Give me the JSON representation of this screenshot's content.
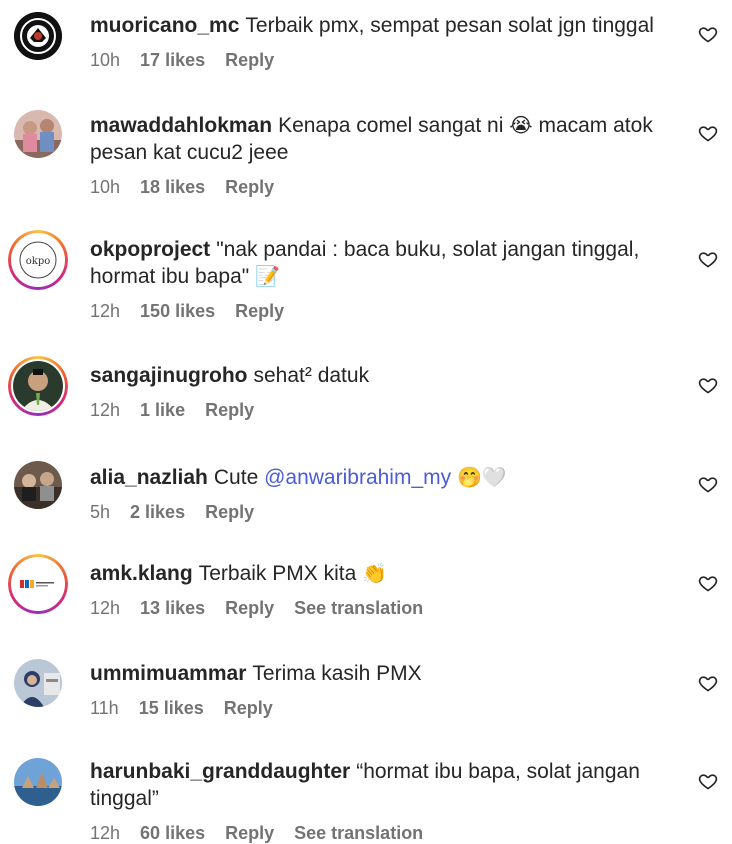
{
  "comments": [
    {
      "username": "muoricano_mc",
      "text": "Terbaik pmx, sempat pesan solat jgn tinggal",
      "time": "10h",
      "likes": "17 likes",
      "reply": "Reply"
    },
    {
      "username": "mawaddahlokman",
      "text_before": "Kenapa comel sangat ni",
      "emoji": "😭",
      "text_after": "macam atok pesan kat cucu2 jeee",
      "time": "10h",
      "likes": "18 likes",
      "reply": "Reply"
    },
    {
      "username": "okpoproject",
      "text": "\"nak pandai : baca buku, solat jangan tinggal, hormat ibu bapa\"",
      "emoji": "📝",
      "time": "12h",
      "likes": "150 likes",
      "reply": "Reply",
      "avatar_text": "okpo"
    },
    {
      "username": "sangajinugroho",
      "text": "sehat² datuk",
      "time": "12h",
      "likes": "1 like",
      "reply": "Reply"
    },
    {
      "username": "alia_nazliah",
      "text": "Cute",
      "mention": "@anwaribrahim_my",
      "emoji": "🤭🤍",
      "time": "5h",
      "likes": "2 likes",
      "reply": "Reply"
    },
    {
      "username": "amk.klang",
      "text": "Terbaik PMX kita",
      "emoji": "👏",
      "time": "12h",
      "likes": "13 likes",
      "reply": "Reply",
      "translate": "See translation"
    },
    {
      "username": "ummimuammar",
      "text": "Terima kasih PMX",
      "time": "11h",
      "likes": "15 likes",
      "reply": "Reply"
    },
    {
      "username": "harunbaki_granddaughter",
      "text": "“hormat ibu bapa, solat jangan tinggal”",
      "time": "12h",
      "likes": "60 likes",
      "reply": "Reply",
      "translate": "See translation"
    }
  ],
  "icons": {
    "like": "heart-outline-icon"
  },
  "colors": {
    "text": "#262626",
    "meta": "#737373",
    "mention": "#4a5cd6"
  }
}
